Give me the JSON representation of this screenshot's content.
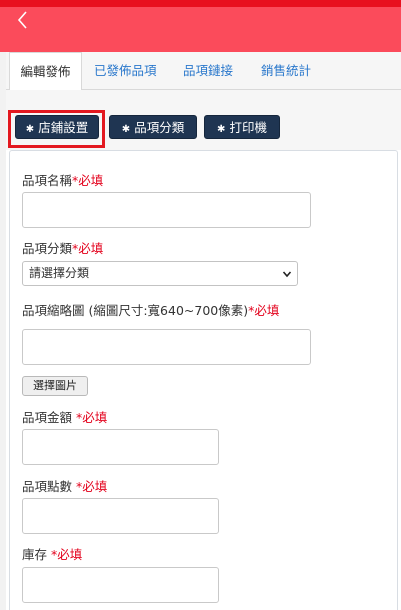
{
  "tabs": [
    {
      "label": "編輯發佈",
      "active": true
    },
    {
      "label": "已發佈品項",
      "active": false
    },
    {
      "label": "品項鏈接",
      "active": false
    },
    {
      "label": "銷售統計",
      "active": false
    }
  ],
  "buttons": {
    "store_settings": "店鋪設置",
    "item_category": "品項分類",
    "printer": "打印機"
  },
  "form": {
    "item_name_label": "品項名稱",
    "item_category_label": "品項分類",
    "item_category_value": "請選擇分類",
    "thumbnail_label": "品項縮略圖 (縮圖尺寸:寬640~700像素)",
    "choose_image": "選擇圖片",
    "amount_label": "品項金額 ",
    "points_label": "品項點數 ",
    "stock_label": "庫存 ",
    "required": "*必填"
  },
  "icons": {
    "back": "chevron-left-icon",
    "gear": "gear-icon",
    "select": "chevron-down-icon"
  },
  "colors": {
    "header": "#fb4b5b",
    "header_line": "#e8101f",
    "button": "#1f3552",
    "required": "#e3001b",
    "tab_link": "#2a78cc",
    "highlight": "#e3181f"
  }
}
